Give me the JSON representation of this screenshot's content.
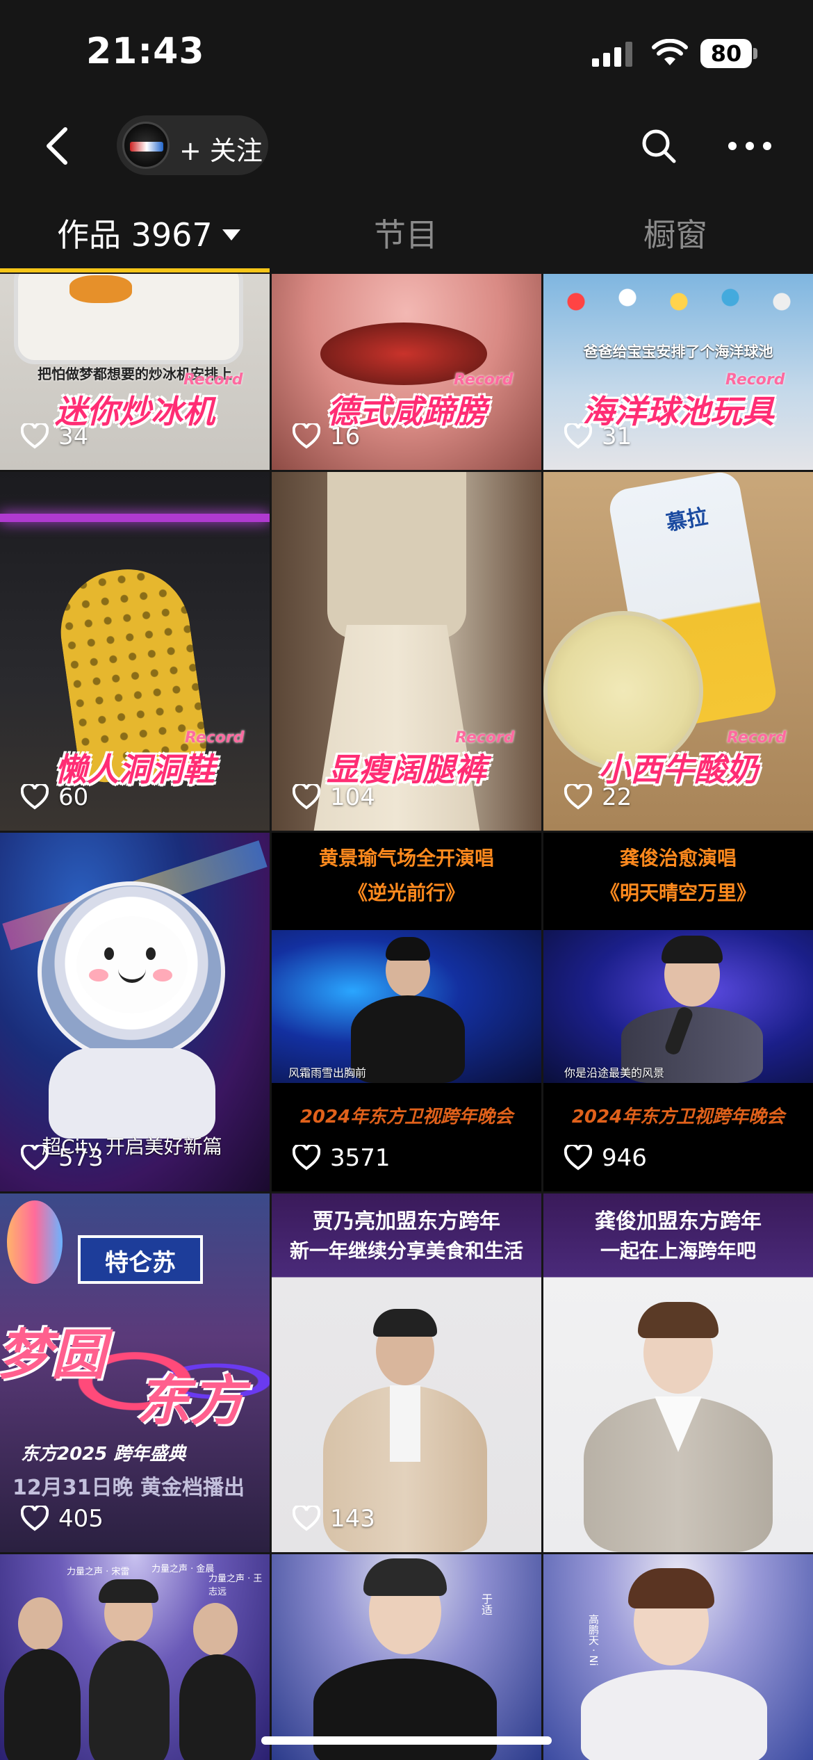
{
  "status": {
    "time": "21:43",
    "battery": "80"
  },
  "nav": {
    "follow_label": "+ 关注"
  },
  "tabs": {
    "works": "作品 3967",
    "shows": "节目",
    "window": "橱窗"
  },
  "tiles": [
    {
      "caption": "把怕做梦都想要的炒冰机安排上",
      "title": "迷你炒冰机",
      "likes": "34"
    },
    {
      "title": "德式咸蹄膀",
      "likes": "16"
    },
    {
      "caption": "爸爸给宝宝安排了个海洋球池",
      "title": "海洋球池玩具",
      "likes": "31"
    },
    {
      "title": "懒人洞洞鞋",
      "likes": "60"
    },
    {
      "title": "显瘦阔腿裤",
      "likes": "104"
    },
    {
      "label": "慕拉",
      "title": "小西牛酸奶",
      "likes": "22"
    },
    {
      "caption": "超City  开启美好新篇",
      "likes": "573"
    },
    {
      "headline": "黄景瑜气场全开演唱",
      "song": "《逆光前行》",
      "sub": "2024年东方卫视跨年晚会",
      "screen_caption": "风霜雨雪出胸前",
      "likes": "3571"
    },
    {
      "headline": "龚俊治愈演唱",
      "song": "《明天晴空万里》",
      "sub": "2024年东方卫视跨年晚会",
      "screen_caption": "你是沿途最美的风景",
      "likes": "946"
    },
    {
      "brand": "特仑苏",
      "title1": "梦圆",
      "title2": "东方",
      "tag": "东方2025  跨年盛典",
      "date": "12月31日晚 黄金档播出",
      "likes": "405"
    },
    {
      "headline": "贾乃亮加盟东方跨年",
      "song": "新一年继续分享美食和生活",
      "likes": "143"
    },
    {
      "headline": "龚俊加盟东方跨年",
      "song": "一起在上海跨年吧"
    },
    {
      "caption": "力量之声 · 宋雷",
      "caption2": "力量之声 · 金晨",
      "caption3": "力量之声 · 王志远"
    },
    {
      "caption": "于适"
    },
    {
      "caption": "高鹏天 · Ni"
    }
  ]
}
